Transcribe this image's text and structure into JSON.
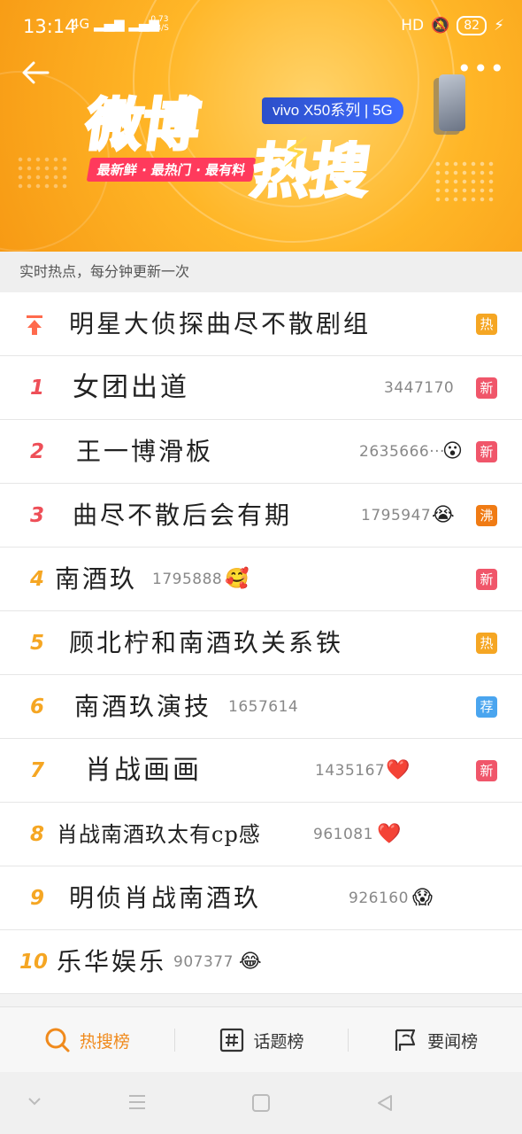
{
  "status_bar": {
    "time": "13:14",
    "network": "4G",
    "speed_value": "0.73",
    "speed_unit": "KB/S",
    "hd": "HD",
    "battery": "82"
  },
  "banner": {
    "logo_text_1": "微博",
    "logo_text_2": "热搜",
    "slogan": "最新鲜 · 最热门 · 最有料",
    "brand": "vivo X50系列 | 5G"
  },
  "subheader": "实时热点，每分钟更新一次",
  "colors": {
    "hot": "#f5a623",
    "new": "#f0566a",
    "boil": "#f07b14",
    "recommend": "#4aa5ef",
    "active_tab": "#f08a1c"
  },
  "rows": [
    {
      "rank": "",
      "title": "明星大侦探曲尽不散剧组",
      "count": "",
      "emoji": "",
      "tag": "热"
    },
    {
      "rank": "1",
      "title": "女团出道",
      "count": "3447170",
      "emoji": "",
      "tag": "新"
    },
    {
      "rank": "2",
      "title": "王一博滑板",
      "count": "2635666···",
      "emoji": "😮",
      "tag": "新"
    },
    {
      "rank": "3",
      "title": "曲尽不散后会有期",
      "count": "1795947",
      "emoji": "😭",
      "tag": "沸"
    },
    {
      "rank": "4",
      "title": "南酒玖",
      "count": "1795888",
      "emoji": "🥰",
      "tag": "新"
    },
    {
      "rank": "5",
      "title": "顾北柠和南酒玖关系铁",
      "count": "",
      "emoji": "",
      "tag": "热"
    },
    {
      "rank": "6",
      "title": "南酒玖演技",
      "count": "1657614",
      "emoji": "",
      "tag": "荐"
    },
    {
      "rank": "7",
      "title": "肖战画画",
      "count": "1435167",
      "emoji": "❤️",
      "tag": "新"
    },
    {
      "rank": "8",
      "title": "肖战南酒玖太有cp感",
      "count": "961081",
      "emoji": "❤️",
      "tag": ""
    },
    {
      "rank": "9",
      "title": "明侦肖战南酒玖",
      "count": "926160",
      "emoji": "😱",
      "tag": ""
    },
    {
      "rank": "10",
      "title": "乐华娱乐",
      "count": "907377",
      "emoji": "😂",
      "tag": ""
    }
  ],
  "tabs": [
    {
      "label": "热搜榜",
      "icon": "search-icon",
      "active": true
    },
    {
      "label": "话题榜",
      "icon": "hashtag-icon",
      "active": false
    },
    {
      "label": "要闻榜",
      "icon": "flag-icon",
      "active": false
    }
  ]
}
